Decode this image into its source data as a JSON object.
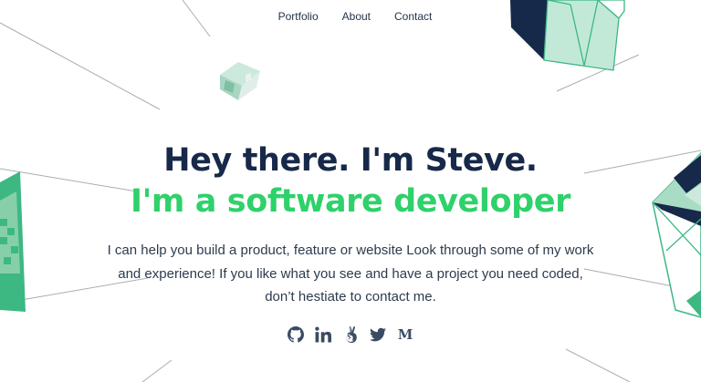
{
  "nav": {
    "items": [
      {
        "label": "Portfolio"
      },
      {
        "label": "About"
      },
      {
        "label": "Contact"
      }
    ]
  },
  "hero": {
    "title": "Hey there. I'm Steve.",
    "subtitle": "I'm a software developer",
    "description": "I can help you build a product, feature or website Look through some of my work and experience! If you like what you see and have a project you need coded, don’t hestiate to contact me."
  },
  "social": {
    "icons": [
      "github-icon",
      "linkedin-icon",
      "angellist-icon",
      "twitter-icon",
      "medium-icon"
    ],
    "medium_letter": "M"
  },
  "colors": {
    "title": "#17294a",
    "accent": "#2ed16a",
    "shape_dark": "#17294a",
    "shape_light": "#bfe8d6",
    "shape_green": "#3db883",
    "lines": "#a9adb3"
  }
}
